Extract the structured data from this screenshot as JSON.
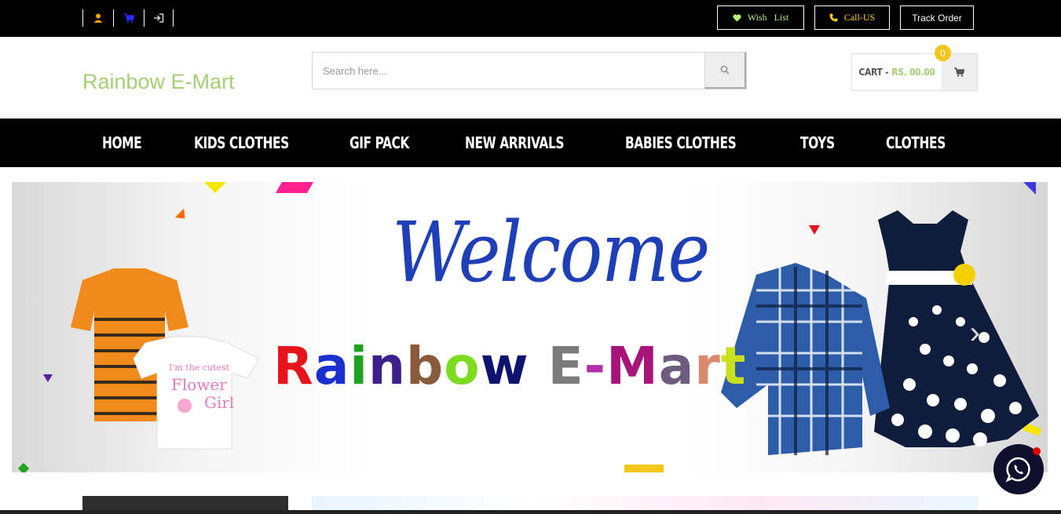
{
  "topbar": {
    "icons": [
      "user-icon",
      "cart-icon",
      "login-icon"
    ],
    "wishlist_label": "Wish   List",
    "call_label": "Call-US",
    "track_label": "Track Order"
  },
  "header": {
    "logo": "Rainbow E-Mart",
    "search_placeholder": "Search here...",
    "cart_label": "CART -",
    "cart_amount": "RS. 00.00",
    "cart_count": "0"
  },
  "nav": {
    "items": [
      "HOME",
      "KIDS CLOTHES",
      "GIF PACK",
      "NEW ARRIVALS",
      "BABIES CLOTHES",
      "TOYS",
      "CLOTHES"
    ]
  },
  "banner": {
    "welcome": "Welcome",
    "brand_letters": [
      "R",
      "a",
      "i",
      "n",
      "b",
      "o",
      "w",
      " ",
      "E",
      "-",
      "M",
      "a",
      "r",
      "t"
    ],
    "brand_colors": [
      "#e8141c",
      "#1b2fd1",
      "#1fa21f",
      "#3b1f8a",
      "#8a5a3c",
      "#7ddc1f",
      "#0c1470",
      "#ffffff",
      "#7b7b7b",
      "#b22fa8",
      "#a8157a",
      "#6d5c7e",
      "#d98a6c",
      "#c9e01a"
    ],
    "next_arrow": "›"
  },
  "colors": {
    "accent_green": "#a6cf76",
    "call_yellow": "#ffd000",
    "badge_yellow": "#f5c518"
  }
}
